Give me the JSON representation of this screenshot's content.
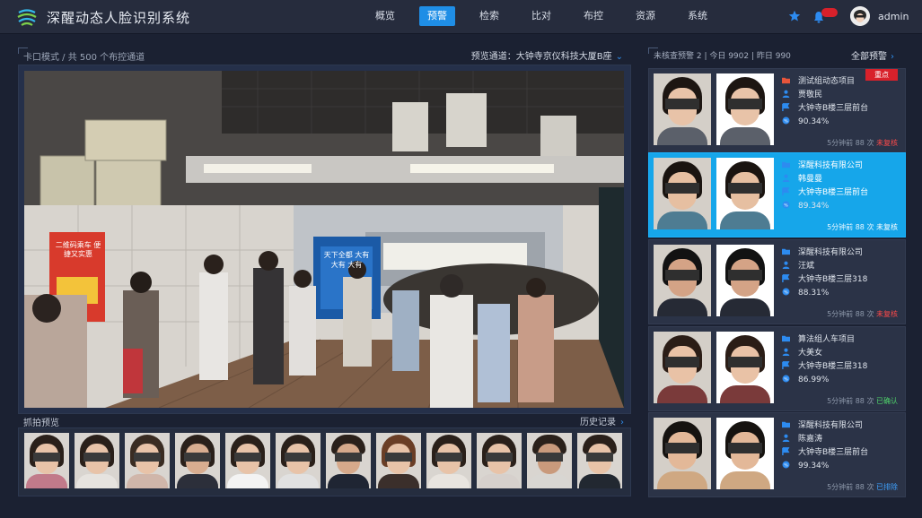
{
  "app": {
    "title": "深醒动态人脸识别系统",
    "username": "admin",
    "accent": "#1f8ee6",
    "nav": [
      {
        "label": "概览",
        "active": false
      },
      {
        "label": "预警",
        "active": true
      },
      {
        "label": "检索",
        "active": false
      },
      {
        "label": "比对",
        "active": false
      },
      {
        "label": "布控",
        "active": false
      },
      {
        "label": "资源",
        "active": false
      },
      {
        "label": "系统",
        "active": false
      }
    ]
  },
  "monitor": {
    "breadcrumb": "卡口模式 / 共 500 个布控通道",
    "channel_label": "预览通道：大钟寺京仪科技大厦B座",
    "capture_title": "抓拍预览",
    "history_label": "历史记录",
    "capture_count": 12
  },
  "alerts": {
    "stats": "未核查预警 2 | 今日 9902 | 昨日 990",
    "all_label": "全部预警",
    "items": [
      {
        "project": "测试组动态项目",
        "name": "贾敬民",
        "location": "大钟寺B楼三层前台",
        "score": "90.34%",
        "time": "5分钟前",
        "count": "88",
        "count_unit": "次",
        "status": "未复核",
        "status_type": "red",
        "ribbon": "重点",
        "active": false
      },
      {
        "project": "深醒科技有限公司",
        "name": "韩曼曼",
        "location": "大钟寺B楼三层前台",
        "score": "89.34%",
        "time": "5分钟前",
        "count": "88",
        "count_unit": "次",
        "status": "未复核",
        "status_type": "white",
        "ribbon": "",
        "active": true
      },
      {
        "project": "深醒科技有限公司",
        "name": "汪斌",
        "location": "大钟寺B楼三层318",
        "score": "88.31%",
        "time": "5分钟前",
        "count": "88",
        "count_unit": "次",
        "status": "未复核",
        "status_type": "red",
        "ribbon": "",
        "active": false
      },
      {
        "project": "算法组人车项目",
        "name": "大美女",
        "location": "大钟寺B楼三层318",
        "score": "86.99%",
        "time": "5分钟前",
        "count": "88",
        "count_unit": "次",
        "status": "已确认",
        "status_type": "green",
        "ribbon": "",
        "active": false
      },
      {
        "project": "深醒科技有限公司",
        "name": "陈嘉涛",
        "location": "大钟寺B楼三层前台",
        "score": "99.34%",
        "time": "5分钟前",
        "count": "88",
        "count_unit": "次",
        "status": "已排除",
        "status_type": "blue",
        "ribbon": "",
        "active": false
      }
    ]
  },
  "video_signs": {
    "poster_text": "二维码乘车 便捷又实惠",
    "billboard_text": "天下全都 大有 大有 大有"
  }
}
